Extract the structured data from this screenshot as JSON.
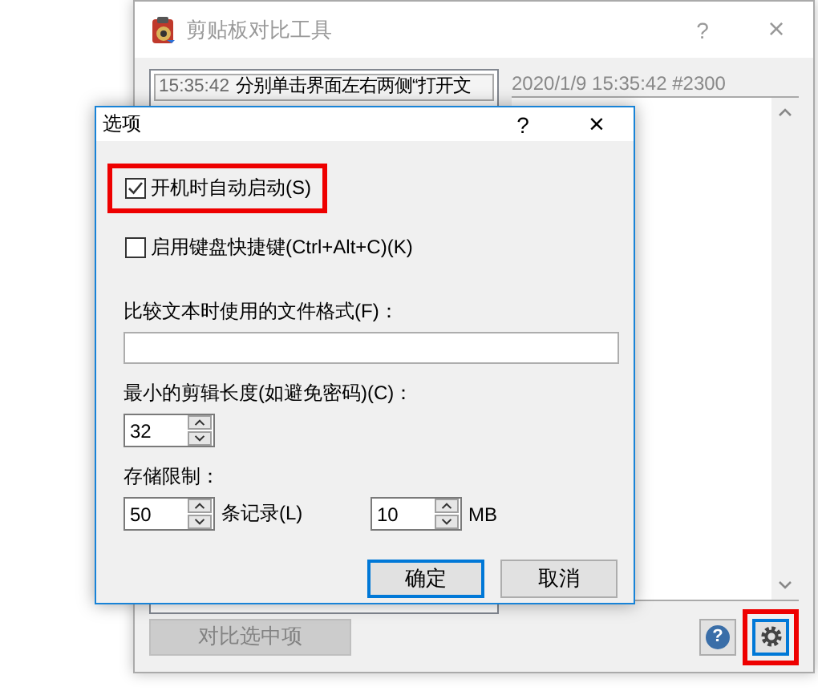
{
  "main_window": {
    "title": "剪贴板对比工具",
    "help_button": "?",
    "close_button": "×",
    "history": [
      {
        "time": "15:35:42",
        "text": "分别单击界面左右两侧“打开文",
        "selected": true
      }
    ],
    "detail": {
      "header": "2020/1/9 15:35:42 #2300"
    },
    "compare_button": {
      "label": "对比选中项",
      "disabled": true
    },
    "help_icon": "?",
    "settings_button": {
      "focused": true,
      "highlighted": true
    }
  },
  "dialog": {
    "title": "选项",
    "help_button": "?",
    "close_button": "×",
    "options": [
      {
        "kind": "checkbox",
        "label": "开机时自动启动(S)",
        "checked": true,
        "highlighted": true
      },
      {
        "kind": "checkbox",
        "label": "启用键盘快捷键(Ctrl+Alt+C)(K)",
        "checked": false,
        "highlighted": false
      },
      {
        "kind": "text",
        "label": "比较文本时使用的文件格式(F)："
      },
      {
        "kind": "spinner",
        "label": "最小的剪辑长度(如避免密码)(C)：",
        "fields": [
          {
            "value": "32"
          }
        ]
      },
      {
        "kind": "spinner",
        "label": "存储限制：",
        "fields": [
          {
            "value": "50",
            "unit": "条记录(L)"
          },
          {
            "value": "10",
            "unit": "MB"
          }
        ]
      }
    ],
    "buttons": [
      {
        "label": "确定",
        "default": true
      },
      {
        "label": "取消",
        "default": false
      }
    ]
  }
}
